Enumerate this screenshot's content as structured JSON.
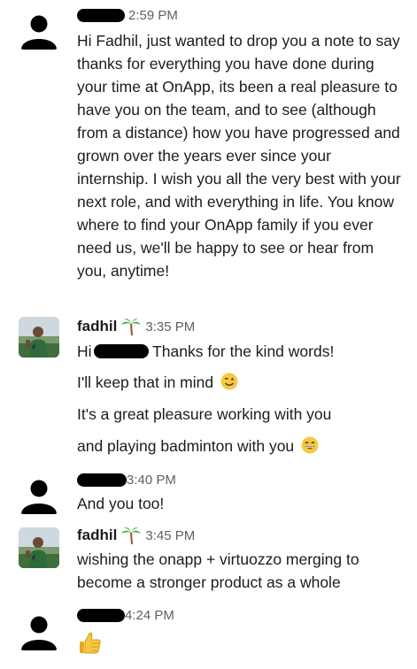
{
  "messages": [
    {
      "time": "2:59 PM",
      "text": "Hi Fadhil, just wanted to drop you a note to say thanks for everything you have done during your time at OnApp, its been a real pleasure to have you on the team, and to see (although from a distance) how you have progressed and grown over the years ever since your internship. I wish you all the very best with your next role, and with everything in life. You know where to find your OnApp family if you ever need us, we'll be happy to see or hear from you, anytime!"
    },
    {
      "name": "fadhil",
      "time": "3:35 PM",
      "lines": [
        {
          "before": "Hi",
          "after": " Thanks for the kind words!"
        },
        {
          "text": "I'll keep that in mind"
        },
        {
          "text": "It's a great pleasure working with you"
        },
        {
          "text": "and playing badminton with you"
        }
      ]
    },
    {
      "time": "3:40 PM",
      "text": "And you too!"
    },
    {
      "name": "fadhil",
      "time": "3:45 PM",
      "lines": [
        {
          "text": "wishing the onapp + virtuozzo merging to"
        },
        {
          "text": "become a stronger product as a whole"
        }
      ]
    },
    {
      "time": "4:24 PM",
      "reaction_icon": "thumbs-up-icon"
    }
  ]
}
